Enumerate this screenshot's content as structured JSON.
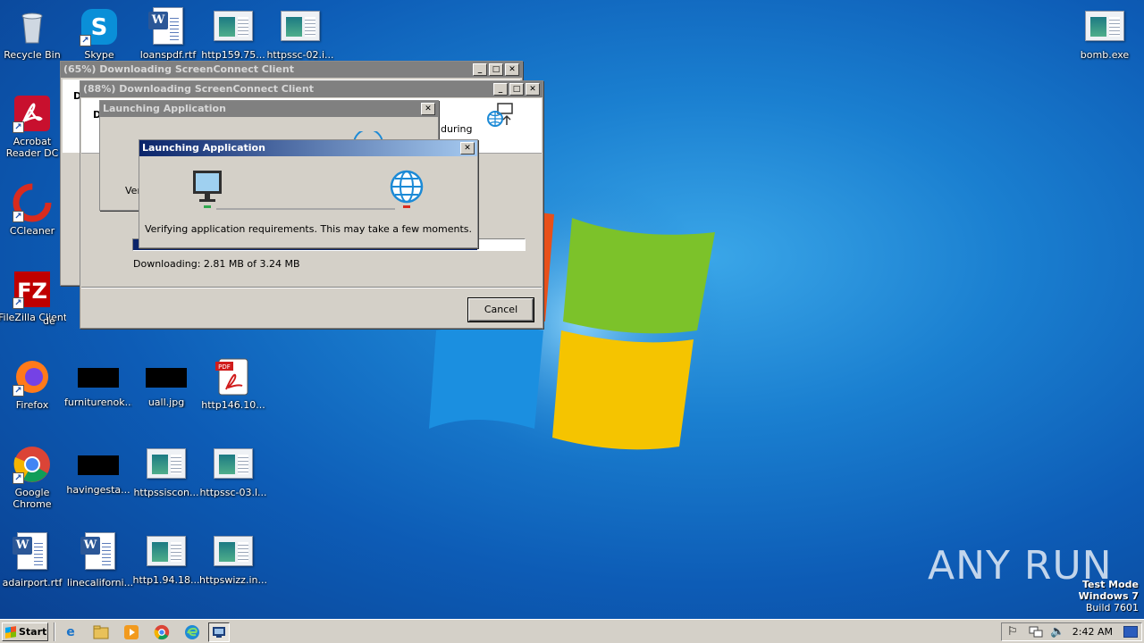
{
  "desktop": {
    "icons": [
      {
        "label": "Recycle Bin",
        "icon": "recycle-bin-icon"
      },
      {
        "label": "Skype",
        "icon": "skype-icon"
      },
      {
        "label": "loanspdf.rtf",
        "icon": "word-document-icon"
      },
      {
        "label": "http159.75...",
        "icon": "web-file-icon"
      },
      {
        "label": "httpssc-02.i...",
        "icon": "web-file-icon"
      },
      {
        "label": "bomb.exe",
        "icon": "application-icon"
      },
      {
        "label": "Acrobat Reader DC",
        "icon": "acrobat-icon"
      },
      {
        "label": "CCleaner",
        "icon": "ccleaner-icon"
      },
      {
        "label": "FileZilla Client",
        "icon": "filezilla-icon"
      },
      {
        "label": "de",
        "icon": "file-icon"
      },
      {
        "label": "Firefox",
        "icon": "firefox-icon"
      },
      {
        "label": "furniturenok...",
        "icon": "image-icon"
      },
      {
        "label": "uall.jpg",
        "icon": "image-icon"
      },
      {
        "label": "http146.10...",
        "icon": "pdf-icon"
      },
      {
        "label": "Google Chrome",
        "icon": "chrome-icon"
      },
      {
        "label": "havingesta...",
        "icon": "image-icon"
      },
      {
        "label": "httpssiscon...",
        "icon": "web-file-icon"
      },
      {
        "label": "httpssc-03.l...",
        "icon": "web-file-icon"
      },
      {
        "label": "adairport.rtf",
        "icon": "word-document-icon"
      },
      {
        "label": "linecaliforni...",
        "icon": "word-document-icon"
      },
      {
        "label": "http1.94.18...",
        "icon": "web-file-icon"
      },
      {
        "label": "httpswizz.in...",
        "icon": "web-file-icon"
      }
    ]
  },
  "windows": {
    "download65": {
      "title": "(65%) Downloading ScreenConnect Client",
      "text_fragment": "D"
    },
    "download88": {
      "title": "(88%) Downloading ScreenConnect Client",
      "text_fragment": "D",
      "side_text": "during",
      "progress_fraction": 0.88,
      "status": "Downloading: 2.81 MB of 3.24 MB",
      "cancel_label": "Cancel"
    },
    "launch_back": {
      "title": "Launching Application",
      "text_fragment": "Ver"
    },
    "launch_front": {
      "title": "Launching Application",
      "message": "Verifying application requirements. This may take a few moments."
    }
  },
  "window_controls": {
    "minimize": "_",
    "maximize": "□",
    "close": "✕"
  },
  "taskbar": {
    "start_label": "Start",
    "clock": "2:42 AM",
    "pinned": [
      "ie-icon",
      "explorer-icon",
      "media-player-icon",
      "chrome-icon",
      "edge-icon",
      "screenconnect-icon"
    ]
  },
  "watermark": {
    "line1": "Test Mode",
    "line2": "Windows 7",
    "line3": "Build 7601",
    "brand": "ANY RUN"
  },
  "colors": {
    "desktop": "#1a7fd0",
    "titlebar_active": "#0a246a",
    "progress": "#0a246a"
  }
}
